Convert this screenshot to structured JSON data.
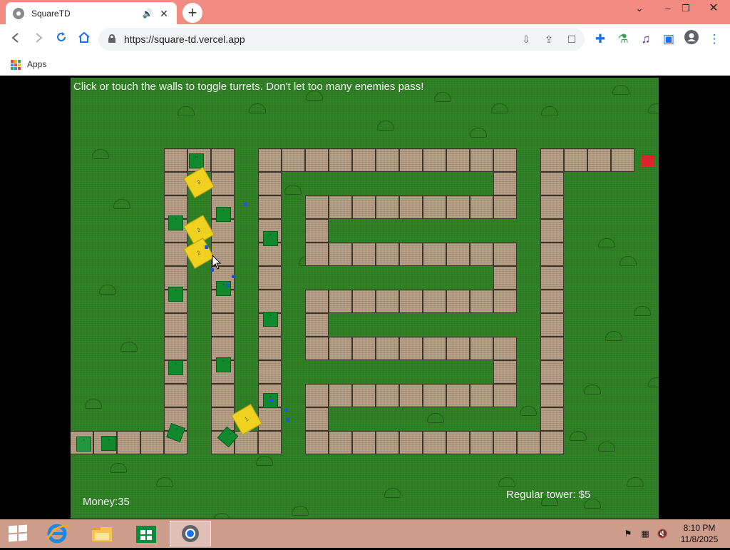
{
  "browser": {
    "tab_title": "SquareTD",
    "url": "https://square-td.vercel.app",
    "bookmarks": {
      "apps_label": "Apps"
    },
    "window_controls": [
      "chevron-down",
      "minimize",
      "restore",
      "close"
    ]
  },
  "game": {
    "instructions": "Click or touch the walls to toggle turrets. Don't let too many enemies pass!",
    "money_label": "Money:35",
    "tower_label": "Regular tower: $5",
    "enemies": [
      "3",
      "3",
      "2",
      "1"
    ]
  },
  "taskbar": {
    "time": "8:10 PM",
    "date": "11/8/2025",
    "apps": [
      "Start",
      "Internet Explorer",
      "File Explorer",
      "Store",
      "Chrome"
    ]
  },
  "colors": {
    "titlebar": "#f28b82",
    "grass": "#2f7f25",
    "wall": "#b39c83",
    "turret": "#118a2e",
    "enemy": "#f0d11f",
    "exit": "#e0232a",
    "bullet": "#2255dd"
  }
}
